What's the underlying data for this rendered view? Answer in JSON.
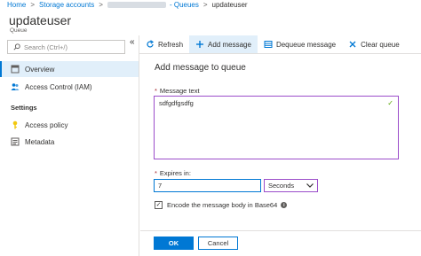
{
  "breadcrumb": {
    "home": "Home",
    "storage_accounts": "Storage accounts",
    "separator": ">",
    "queues_prefix": "- Queues",
    "current": "updateuser"
  },
  "header": {
    "title": "updateuser",
    "type": "Queue"
  },
  "sidebar": {
    "search_placeholder": "Search (Ctrl+/)",
    "collapse_glyph": "«",
    "items": [
      {
        "label": "Overview",
        "icon": "overview-icon",
        "active": true
      },
      {
        "label": "Access Control (IAM)",
        "icon": "people-icon",
        "active": false
      }
    ],
    "section_settings": "Settings",
    "settings_items": [
      {
        "label": "Access policy",
        "icon": "key-icon"
      },
      {
        "label": "Metadata",
        "icon": "metadata-icon"
      }
    ]
  },
  "toolbar": {
    "refresh": "Refresh",
    "add_message": "Add message",
    "dequeue_message": "Dequeue message",
    "clear_queue": "Clear queue"
  },
  "panel": {
    "title": "Add message to queue",
    "message_label": "Message text",
    "message_value": "sdfgdfgsdfg",
    "expires_label": "Expires in:",
    "expires_value": "7",
    "expires_unit": "Seconds",
    "encode_label": "Encode the message body in Base64",
    "encode_checked": true,
    "ok": "OK",
    "cancel": "Cancel"
  },
  "colors": {
    "accent": "#0078d4",
    "focus_border": "#9b4dca",
    "valid_check": "#57a300",
    "required": "#a4262c"
  }
}
